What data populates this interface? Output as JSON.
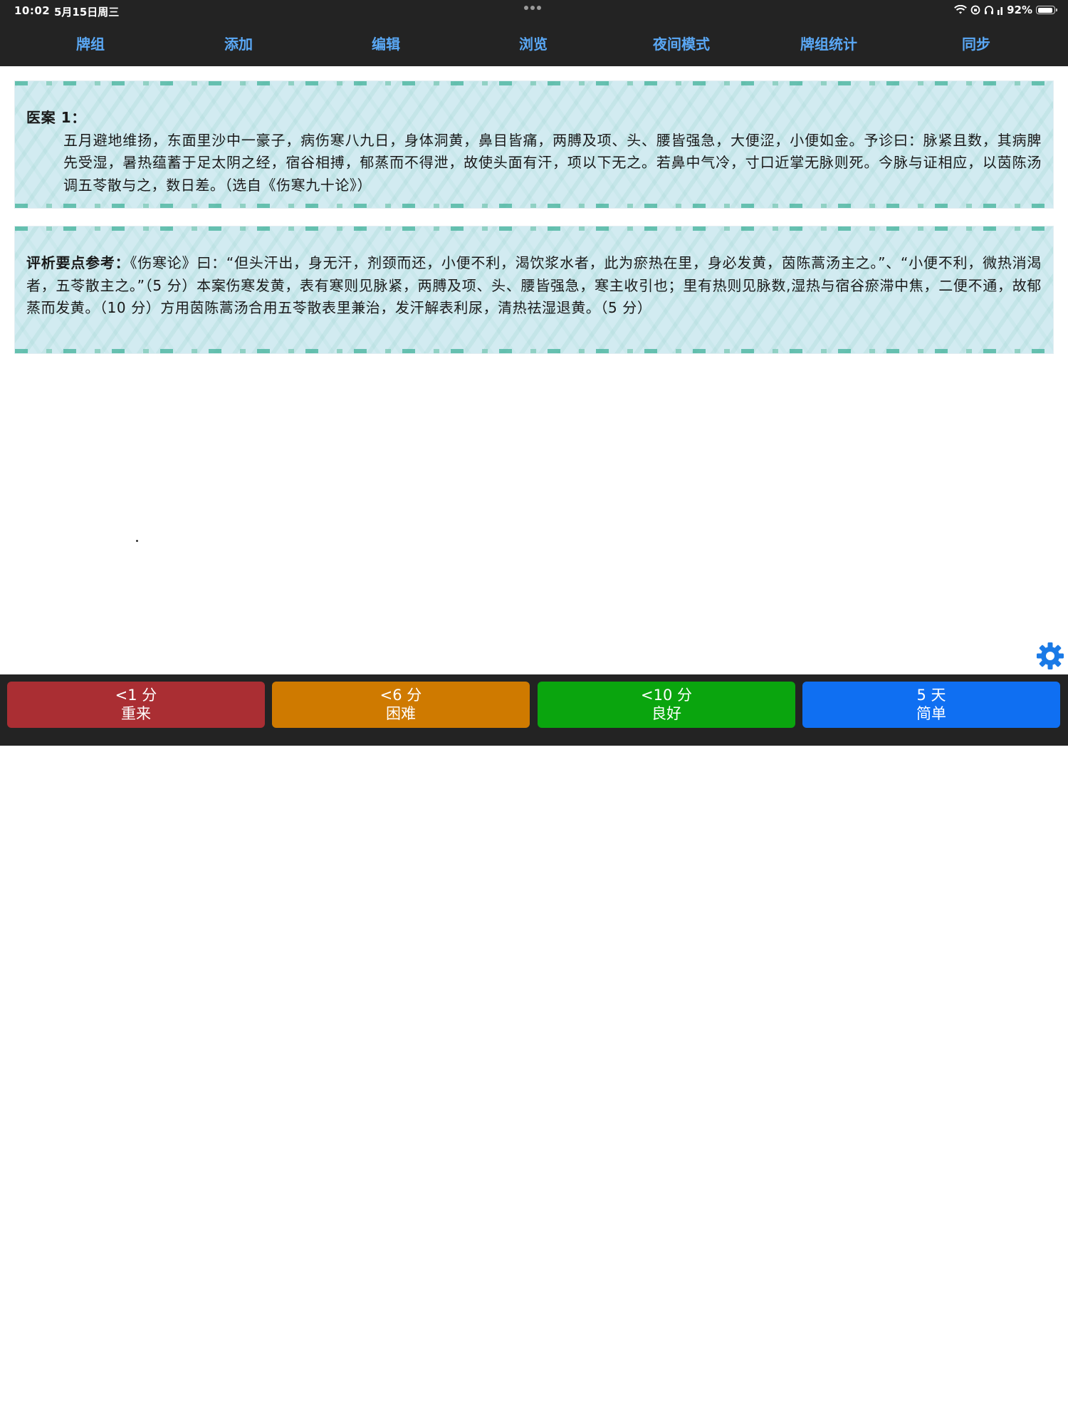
{
  "status_bar": {
    "time": "10:02",
    "date": "5月15日周三",
    "battery_percent": "92%",
    "battery_level": 0.92
  },
  "nav": {
    "items": [
      {
        "label": "牌组"
      },
      {
        "label": "添加"
      },
      {
        "label": "编辑"
      },
      {
        "label": "浏览"
      },
      {
        "label": "夜间模式"
      },
      {
        "label": "牌组统计"
      },
      {
        "label": "同步"
      }
    ]
  },
  "card_front": {
    "heading": "医案 1：",
    "body": "五月避地维扬，东面里沙中一豪子，病伤寒八九日，身体洞黄，鼻目皆痛，两膊及项、头、腰皆强急，大便涩，小便如金。予诊曰：脉紧且数，其病脾先受湿，暑热蕴蓄于足太阴之经，宿谷相搏，郁蒸而不得泄，故使头面有汗，项以下无之。若鼻中气冷，寸口近掌无脉则死。今脉与证相应，以茵陈汤调五苓散与之，数日差。（选自《伤寒九十论》）"
  },
  "card_back": {
    "heading": "评析要点参考：",
    "body": "《伤寒论》曰：“但头汗出，身无汗，剂颈而还，小便不利，渴饮浆水者，此为瘀热在里，身必发黄，茵陈蒿汤主之。”、“小便不利，微热消渴者，五苓散主之。”（5 分）本案伤寒发黄，表有寒则见脉紧，两膊及项、头、腰皆强急，寒主收引也；里有热则见脉数,湿热与宿谷瘀滞中焦，二便不通，故郁蒸而发黄。（10 分）方用茵陈蒿汤合用五苓散表里兼治，发汗解表利尿，清热祛湿退黄。（5 分）"
  },
  "answers": {
    "again": {
      "interval": "<1 分",
      "label": "重来",
      "color": "#aa2e33"
    },
    "hard": {
      "interval": "<6 分",
      "label": "困难",
      "color": "#cf7a00"
    },
    "good": {
      "interval": "<10 分",
      "label": "良好",
      "color": "#0aa50e"
    },
    "easy": {
      "interval": "5 天",
      "label": "简单",
      "color": "#0f6ff2"
    }
  },
  "settings_icon": "gear-icon",
  "colors": {
    "nav_text": "#5aa8f5",
    "bar_background": "#232323",
    "card_background": "#d2ebf1"
  }
}
